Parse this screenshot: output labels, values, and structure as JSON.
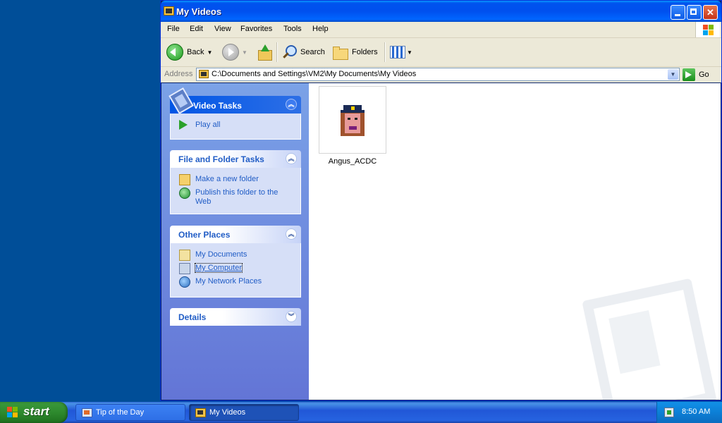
{
  "window": {
    "title": "My Videos"
  },
  "menu": [
    "File",
    "Edit",
    "View",
    "Favorites",
    "Tools",
    "Help"
  ],
  "toolbar": {
    "back": "Back",
    "search": "Search",
    "folders": "Folders"
  },
  "address": {
    "label": "Address",
    "path": "C:\\Documents and Settings\\VM2\\My Documents\\My Videos",
    "go": "Go"
  },
  "taskpane": {
    "video_tasks": {
      "title": "Video Tasks",
      "items": [
        "Play all"
      ]
    },
    "file_folder_tasks": {
      "title": "File and Folder Tasks",
      "items": [
        "Make a new folder",
        "Publish this folder to the Web"
      ]
    },
    "other_places": {
      "title": "Other Places",
      "items": [
        "My Documents",
        "My Computer",
        "My Network Places"
      ]
    },
    "details": {
      "title": "Details"
    }
  },
  "files": [
    {
      "name": "Angus_ACDC"
    }
  ],
  "taskbar": {
    "start": "start",
    "buttons": [
      "Tip of the Day",
      "My Videos"
    ],
    "clock": "8:50 AM"
  }
}
